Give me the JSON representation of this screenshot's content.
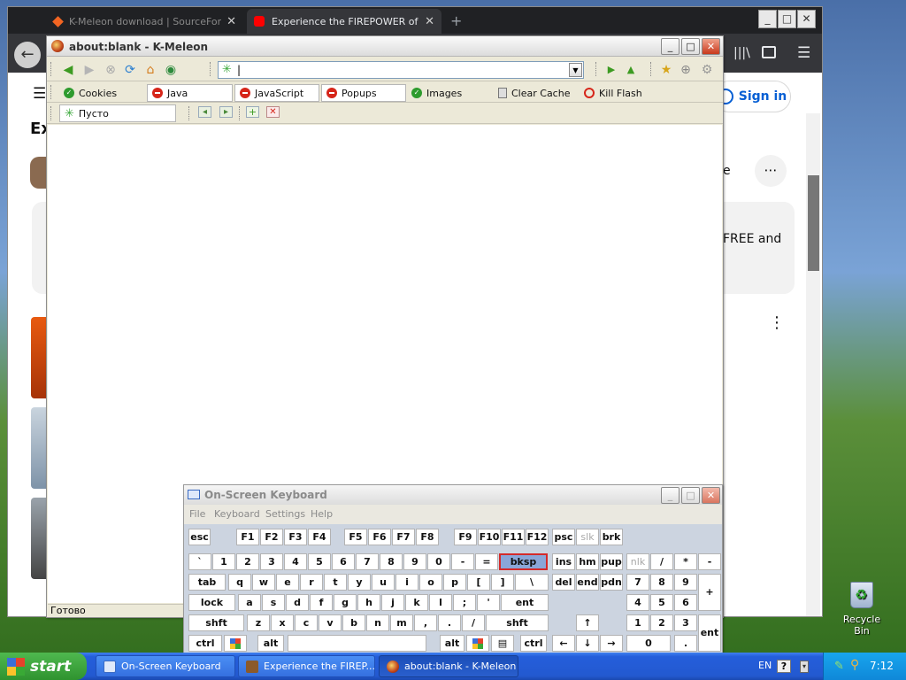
{
  "background_browser": {
    "tabs": [
      {
        "label": "K-Meleon download | SourceForge",
        "active": false
      },
      {
        "label": "Experience the FIREPOWER of the",
        "active": true
      }
    ],
    "new_tab": "+",
    "window_buttons": [
      "_",
      "□",
      "✕"
    ],
    "page": {
      "sign_in": "Sign in",
      "heading_fragment": "Ex",
      "channel_fragment": "e",
      "description_fragment": "FREE and",
      "more": "⋯"
    }
  },
  "kmeleon": {
    "title": "about:blank - K-Meleon",
    "window_buttons": [
      "_",
      "□",
      "✕"
    ],
    "url": "",
    "privacy_buttons": [
      {
        "label": "Cookies",
        "state": "on"
      },
      {
        "label": "Java",
        "state": "off"
      },
      {
        "label": "JavaScript",
        "state": "off"
      },
      {
        "label": "Popups",
        "state": "off"
      },
      {
        "label": "Images",
        "state": "on"
      },
      {
        "label": "Clear Cache",
        "state": "action"
      },
      {
        "label": "Kill Flash",
        "state": "action"
      }
    ],
    "tab_label": "Пусто",
    "status": "Готово"
  },
  "osk": {
    "title": "On-Screen Keyboard",
    "menu": [
      "File",
      "Keyboard",
      "Settings",
      "Help"
    ],
    "window_buttons": [
      "_",
      "□",
      "✕"
    ],
    "rows": [
      [
        "esc",
        "F1",
        "F2",
        "F3",
        "F4",
        "F5",
        "F6",
        "F7",
        "F8",
        "F9",
        "F10",
        "F11",
        "F12",
        "psc",
        "slk",
        "brk"
      ],
      [
        "`",
        "1",
        "2",
        "3",
        "4",
        "5",
        "6",
        "7",
        "8",
        "9",
        "0",
        "-",
        "=",
        "bksp",
        "ins",
        "hm",
        "pup",
        "nlk",
        "/",
        "*",
        "-"
      ],
      [
        "tab",
        "q",
        "w",
        "e",
        "r",
        "t",
        "y",
        "u",
        "i",
        "o",
        "p",
        "[",
        "]",
        "\\",
        "del",
        "end",
        "pdn",
        "7",
        "8",
        "9",
        "+"
      ],
      [
        "lock",
        "a",
        "s",
        "d",
        "f",
        "g",
        "h",
        "j",
        "k",
        "l",
        ";",
        "'",
        "ent",
        "4",
        "5",
        "6"
      ],
      [
        "shft",
        "z",
        "x",
        "c",
        "v",
        "b",
        "n",
        "m",
        ",",
        ".",
        "/",
        "shft",
        "↑",
        "1",
        "2",
        "3",
        "ent"
      ],
      [
        "ctrl",
        "alt",
        "alt",
        "ctrl",
        "←",
        "↓",
        "→",
        "0",
        "."
      ]
    ]
  },
  "taskbar": {
    "start": "start",
    "tasks": [
      {
        "label": "On-Screen Keyboard",
        "active": false
      },
      {
        "label": "Experience the FIREP...",
        "active": false
      },
      {
        "label": "about:blank - K-Meleon",
        "active": true
      }
    ],
    "language": "EN",
    "clock": "7:12"
  },
  "desktop": {
    "recycle_bin": "Recycle Bin"
  },
  "colors": {
    "taskbar": "#245edb",
    "start": "#3c9e3c",
    "bksp_highlight": "#8aa6d8",
    "bksp_border": "#d52a2a"
  }
}
